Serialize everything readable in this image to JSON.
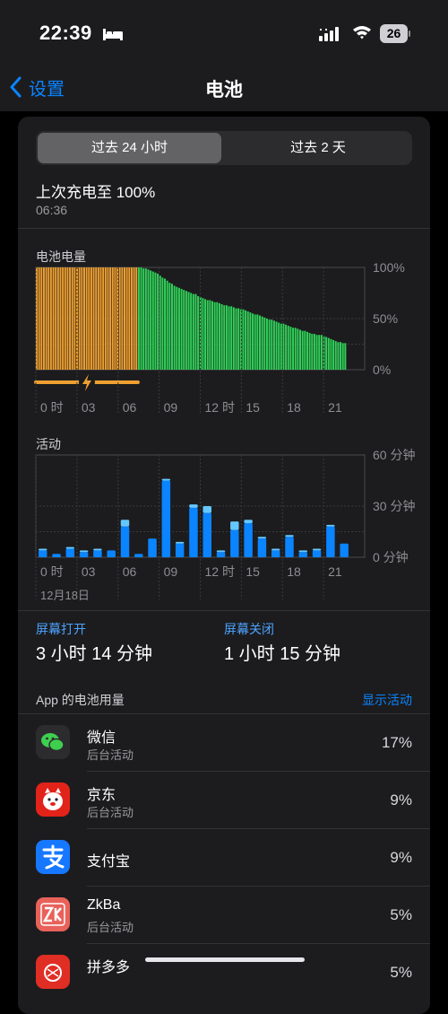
{
  "status_bar": {
    "time": "22:39",
    "battery_level": "26"
  },
  "nav": {
    "back_label": "设置",
    "title": "电池"
  },
  "segments": {
    "selected": "过去 24 小时",
    "other": "过去 2 天"
  },
  "last_charge": {
    "title": "上次充电至 100%",
    "time": "06:36"
  },
  "battery_chart": {
    "label": "电池电量"
  },
  "activity_chart": {
    "label": "活动",
    "date_label": "12月18日"
  },
  "screen": {
    "on_label": "屏幕打开",
    "on_value": "3 小时 14 分钟",
    "off_label": "屏幕关闭",
    "off_value": "1 小时 15 分钟"
  },
  "usage": {
    "label": "App 的电池用量",
    "link": "显示活动"
  },
  "apps": [
    {
      "name": "微信",
      "sub": "后台活动",
      "pct": "17%",
      "icon": "wechat-icon"
    },
    {
      "name": "京东",
      "sub": "后台活动",
      "pct": "9%",
      "icon": "jd-icon"
    },
    {
      "name": "支付宝",
      "sub": "",
      "pct": "9%",
      "icon": "alipay-icon"
    },
    {
      "name": "ZkBa",
      "sub": "后台活动",
      "pct": "5%",
      "icon": "zkba-icon"
    },
    {
      "name": "拼多多",
      "sub": "",
      "pct": "5%",
      "icon": "pinduoduo-icon"
    }
  ],
  "colors": {
    "charging": "#f0a030",
    "battery": "#30d158",
    "screen_on": "#0a84ff",
    "screen_off": "#64c8ff",
    "link": "#0a84ff"
  },
  "chart_data": [
    {
      "type": "bar",
      "title": "电池电量",
      "x_ticks": [
        "0 时",
        "03",
        "06",
        "09",
        "12 时",
        "15",
        "18",
        "21"
      ],
      "y_ticks": [
        "100%",
        "50%",
        "0%"
      ],
      "ylim": [
        0,
        100
      ],
      "charging_until": "06:36",
      "charging_values": [
        100,
        100,
        100,
        100,
        100,
        100,
        100,
        100,
        100,
        100,
        100,
        100,
        100,
        100,
        100,
        100,
        100,
        100,
        100,
        100,
        100,
        100,
        100,
        100,
        100,
        100,
        100,
        100,
        100,
        100,
        100,
        100,
        100,
        100,
        100,
        100,
        100,
        100,
        100,
        100,
        100,
        100,
        100
      ],
      "values": [
        100,
        100,
        99,
        99,
        98,
        97,
        96,
        95,
        94,
        92,
        90,
        89,
        87,
        85,
        84,
        82,
        81,
        80,
        79,
        78,
        77,
        76,
        75,
        74,
        74,
        72,
        71,
        70,
        69,
        68,
        68,
        67,
        66,
        66,
        65,
        64,
        63,
        63,
        62,
        62,
        61,
        60,
        60,
        59,
        59,
        58,
        57,
        56,
        55,
        54,
        54,
        53,
        52,
        51,
        50,
        49,
        49,
        48,
        47,
        46,
        45,
        45,
        44,
        43,
        42,
        41,
        41,
        40,
        39,
        38,
        38,
        37,
        36,
        35,
        35,
        34,
        34,
        34,
        33,
        32,
        31,
        30,
        29,
        28,
        27,
        27,
        26,
        26
      ]
    },
    {
      "type": "bar",
      "title": "活动",
      "x_ticks": [
        "0 时",
        "03",
        "06",
        "09",
        "12 时",
        "15",
        "18",
        "21"
      ],
      "y_ticks": [
        "60 分钟",
        "30 分钟",
        "0 分钟"
      ],
      "ylim": [
        0,
        60
      ],
      "series": [
        {
          "name": "屏幕打开",
          "values": [
            4,
            2,
            5,
            3,
            4,
            4,
            18,
            2,
            11,
            45,
            8,
            29,
            26,
            3,
            16,
            20,
            11,
            4,
            12,
            3,
            4,
            18,
            8
          ]
        },
        {
          "name": "屏幕关闭",
          "values": [
            1,
            0,
            1,
            1,
            1,
            0,
            4,
            0,
            0,
            1,
            1,
            2,
            4,
            1,
            5,
            2,
            1,
            1,
            1,
            1,
            1,
            1,
            0
          ]
        }
      ]
    }
  ]
}
